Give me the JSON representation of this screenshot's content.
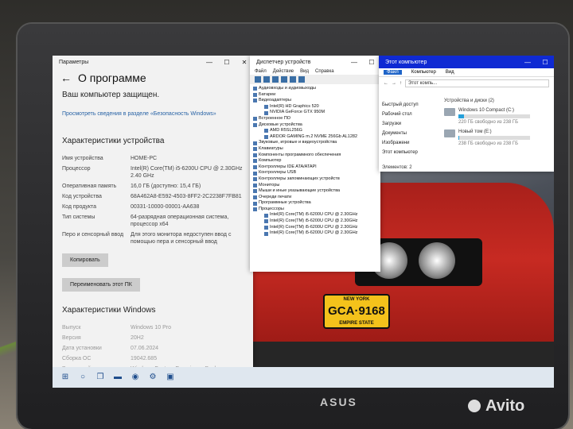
{
  "settings": {
    "window_title": "Параметры",
    "back_glyph": "←",
    "page_title": "О программе",
    "protected": "Ваш компьютер защищен.",
    "security_link": "Просмотреть сведения в разделе «Безопасность Windows»",
    "device_heading": "Характеристики устройства",
    "specs": [
      {
        "k": "Имя устройства",
        "v": "HOME-PC"
      },
      {
        "k": "Процессор",
        "v": "Intel(R) Core(TM) i5-6200U CPU @ 2.30GHz 2.40 GHz"
      },
      {
        "k": "Оперативная память",
        "v": "16,0 ГБ (доступно: 15,4 ГБ)"
      },
      {
        "k": "Код устройства",
        "v": "68A462A8-E592-4503-8FF2-2C2238F7FB81"
      },
      {
        "k": "Код продукта",
        "v": "00331-10000-00001-AA638"
      },
      {
        "k": "Тип системы",
        "v": "64-разрядная операционная система, процессор x64"
      },
      {
        "k": "Перо и сенсорный ввод",
        "v": "Для этого монитора недоступен ввод с помощью пера и сенсорный ввод"
      }
    ],
    "copy_button": "Копировать",
    "rename_button": "Переименовать этот ПК",
    "windows_heading": "Характеристики Windows",
    "win_specs": [
      {
        "k": "Выпуск",
        "v": "Windows 10 Pro"
      },
      {
        "k": "Версия",
        "v": "20H2"
      },
      {
        "k": "Дата установки",
        "v": "07.06.2024"
      },
      {
        "k": "Сборка ОС",
        "v": "19042.685"
      },
      {
        "k": "Взаимодействие",
        "v": "Windows Feature Experience Pack"
      }
    ]
  },
  "devmgr": {
    "title": "Диспетчер устройств",
    "menu": [
      "Файл",
      "Действие",
      "Вид",
      "Справка"
    ],
    "tree": [
      {
        "t": "Аудиовходы и аудиовыходы",
        "c": false
      },
      {
        "t": "Батареи",
        "c": false
      },
      {
        "t": "Видеоадаптеры",
        "c": false
      },
      {
        "t": "Intel(R) HD Graphics 520",
        "c": true
      },
      {
        "t": "NVIDIA GeForce GTX 950M",
        "c": true
      },
      {
        "t": "Встроенное ПО",
        "c": false
      },
      {
        "t": "Дисковые устройства",
        "c": false
      },
      {
        "t": "AMD R5SL256G",
        "c": true
      },
      {
        "t": "ARDOR GAMING m.2 NVME 256Gb AL1282",
        "c": true
      },
      {
        "t": "Звуковые, игровые и видеоустройства",
        "c": false
      },
      {
        "t": "Клавиатуры",
        "c": false
      },
      {
        "t": "Компоненты программного обеспечения",
        "c": false
      },
      {
        "t": "Компьютер",
        "c": false
      },
      {
        "t": "Контроллеры IDE ATA/ATAPI",
        "c": false
      },
      {
        "t": "Контроллеры USB",
        "c": false
      },
      {
        "t": "Контроллеры запоминающих устройств",
        "c": false
      },
      {
        "t": "Мониторы",
        "c": false
      },
      {
        "t": "Мыши и иные указывающие устройства",
        "c": false
      },
      {
        "t": "Очереди печати",
        "c": false
      },
      {
        "t": "Программные устройства",
        "c": false
      },
      {
        "t": "Процессоры",
        "c": false
      },
      {
        "t": "Intel(R) Core(TM) i5-6200U CPU @ 2.30GHz",
        "c": true
      },
      {
        "t": "Intel(R) Core(TM) i5-6200U CPU @ 2.30GHz",
        "c": true
      },
      {
        "t": "Intel(R) Core(TM) i5-6200U CPU @ 2.30GHz",
        "c": true
      },
      {
        "t": "Intel(R) Core(TM) i5-6200U CPU @ 2.30GHz",
        "c": true
      }
    ]
  },
  "explorer": {
    "title": "Этот компьютер",
    "ribbon": [
      "Файл",
      "Компьютер",
      "Вид"
    ],
    "address": "Этот компь...",
    "nav": [
      "Быстрый доступ",
      "Рабочий стол",
      "Загрузки",
      "Документы",
      "Изображени",
      "Этот компьютер"
    ],
    "group": "Устройства и диски (2)",
    "drives": [
      {
        "name": "Windows 10 Compact (C:)",
        "free": "220 ГБ свободно из 238 ГБ",
        "used": 0.08
      },
      {
        "name": "Новый том (E:)",
        "free": "238 ГБ свободно из 238 ГБ",
        "used": 0.01
      }
    ],
    "status": "Элементов: 2"
  },
  "car": {
    "plate": "GCA·9168",
    "plate_top": "NEW YORK",
    "plate_bottom": "EMPIRE STATE"
  },
  "laptop_brand": "ASUS",
  "watermark": "Avito"
}
